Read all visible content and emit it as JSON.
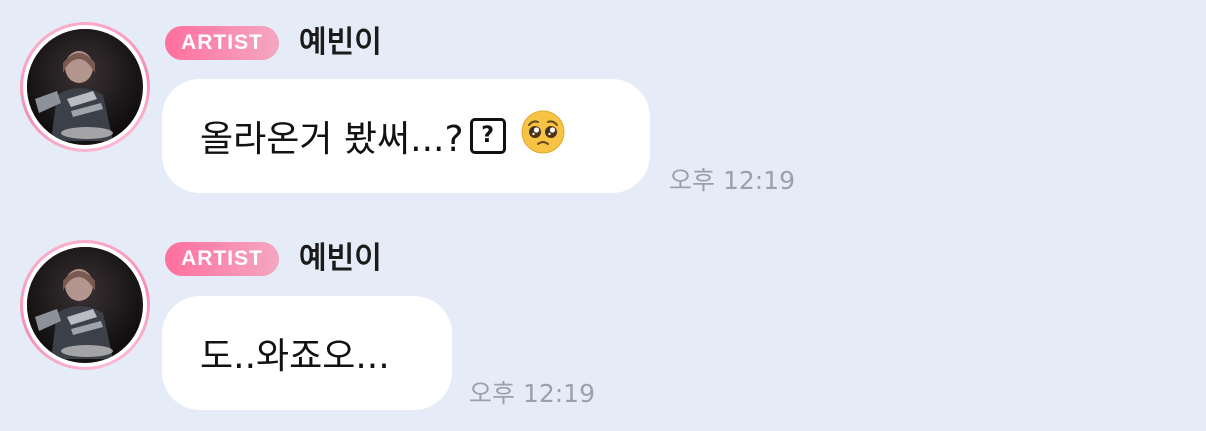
{
  "messages": [
    {
      "badge": "ARTIST",
      "sender": "예빈이",
      "text": "올라온거 봤써...?",
      "question_icon": "?",
      "emoji": "pleading-face-emoji",
      "time": "오후 12:19"
    },
    {
      "badge": "ARTIST",
      "sender": "예빈이",
      "text": "도..와죠오...",
      "time": "오후 12:19"
    }
  ],
  "colors": {
    "background": "#e6ecf7",
    "bubble": "#ffffff",
    "badge_start": "#ff6f9d",
    "badge_end": "#f4a7c2",
    "avatar_ring": "#f48fb7",
    "timestamp": "#9aa1ab"
  }
}
